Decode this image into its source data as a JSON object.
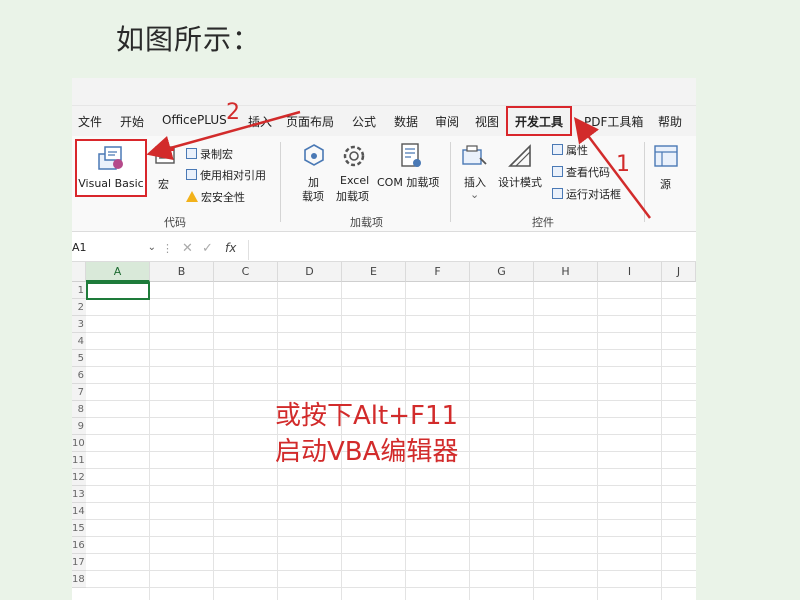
{
  "caption": "如图所示：",
  "ribbon_tabs": [
    "文件",
    "开始",
    "OfficePLUS",
    "插入",
    "页面布局",
    "公式",
    "数据",
    "审阅",
    "视图",
    "开发工具",
    "PDF工具箱",
    "帮助"
  ],
  "active_tab": "开发工具",
  "code_group": {
    "visual_basic": "Visual Basic",
    "macro": "宏",
    "record_macro": "录制宏",
    "use_relative": "使用相对引用",
    "macro_security": "宏安全性",
    "label": "代码"
  },
  "addins_group": {
    "addins_line1": "加",
    "addins_line2": "载项",
    "excel_line1": "Excel",
    "excel_line2": "加载项",
    "com": "COM 加载项",
    "label": "加载项"
  },
  "controls_group": {
    "insert": "插入",
    "design_mode": "设计模式",
    "properties": "属性",
    "view_code": "查看代码",
    "run_dialog": "运行对话框",
    "label": "控件"
  },
  "source": "源",
  "name_box": "A1",
  "fx_symbol": "fx",
  "columns": [
    "A",
    "B",
    "C",
    "D",
    "E",
    "F",
    "G",
    "H",
    "I",
    "J"
  ],
  "rows": [
    "1",
    "2",
    "3",
    "4",
    "5",
    "6",
    "7",
    "8",
    "9",
    "10",
    "11",
    "12",
    "13",
    "14",
    "15",
    "16",
    "17",
    "18"
  ],
  "annotation": {
    "line1": "或按下Alt+F11",
    "line2": "启动VBA编辑器",
    "step1": "1",
    "step2": "2"
  },
  "colors": {
    "annotation_red": "#d22b2b",
    "excel_green": "#1e7b3a",
    "background": "#eaf3e8"
  }
}
